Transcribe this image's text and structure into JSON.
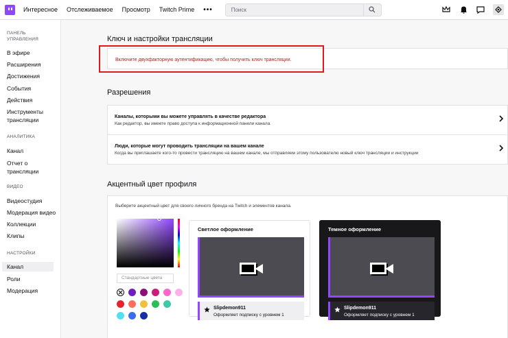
{
  "topnav": {
    "links": [
      "Интересное",
      "Отслеживаемое",
      "Просмотр",
      "Twitch Prime"
    ],
    "more": "•••",
    "search_placeholder": "Поиск"
  },
  "sidebar": {
    "sections": [
      {
        "title": "ПАНЕЛЬ УПРАВЛЕНИЯ",
        "items": [
          "В эфире",
          "Расширения",
          "Достижения",
          "События",
          "Действия",
          "Инструменты трансляции"
        ]
      },
      {
        "title": "АНАЛИТИКА",
        "items": [
          "Канал",
          "Отчет о трансляции"
        ]
      },
      {
        "title": "ВИДЕО",
        "items": [
          "Видеостудия",
          "Модерация видео",
          "Коллекции",
          "Клипы"
        ]
      },
      {
        "title": "НАСТРОЙКИ",
        "items": [
          "Канал",
          "Роли",
          "Модерация"
        ]
      }
    ],
    "active_item": "Канал"
  },
  "stream_key": {
    "heading": "Ключ и настройки трансляции",
    "alert": "Включите двухфакторную аутентификацию, чтобы получить ключ трансляции."
  },
  "permissions": {
    "heading": "Разрешения",
    "rows": [
      {
        "title": "Каналы, которыми вы можете управлять в качестве редактора",
        "subtitle": "Как редактор, вы имеете право доступа к информационной панели канала"
      },
      {
        "title": "Люди, которые могут проводить трансляции на вашем канале",
        "subtitle": "Когда вы приглашаете кого-то провести трансляцию на вашем канале, мы отправляем этому пользователю новый ключ трансляции и инструкции"
      }
    ]
  },
  "accent": {
    "heading": "Акцентный цвет профиля",
    "description": "Выберите акцентный цвет для своего личного бренда на Twitch и элементов канала.",
    "standard_colors_placeholder": "Стандартные цвета",
    "swatches": [
      "#ffffff",
      "#6f1fbf",
      "#8c1078",
      "#cc1e78",
      "#ff66cc",
      "#ffb0eb",
      "#e8222d",
      "#ff6e5c",
      "#f0c040",
      "#2cbe55",
      "#40c8a8",
      "#52e0f0",
      "#3a6cf0",
      "#162fa6"
    ],
    "light_theme": {
      "title": "Светлое оформление",
      "user": "Slipdemon911",
      "line": "Оформляет подписку с уровнем 1"
    },
    "dark_theme": {
      "title": "Темное оформление",
      "user": "Slipdemon911",
      "line": "Оформляет подписку с уровнем 1"
    },
    "accent_color": "#9146ff"
  }
}
